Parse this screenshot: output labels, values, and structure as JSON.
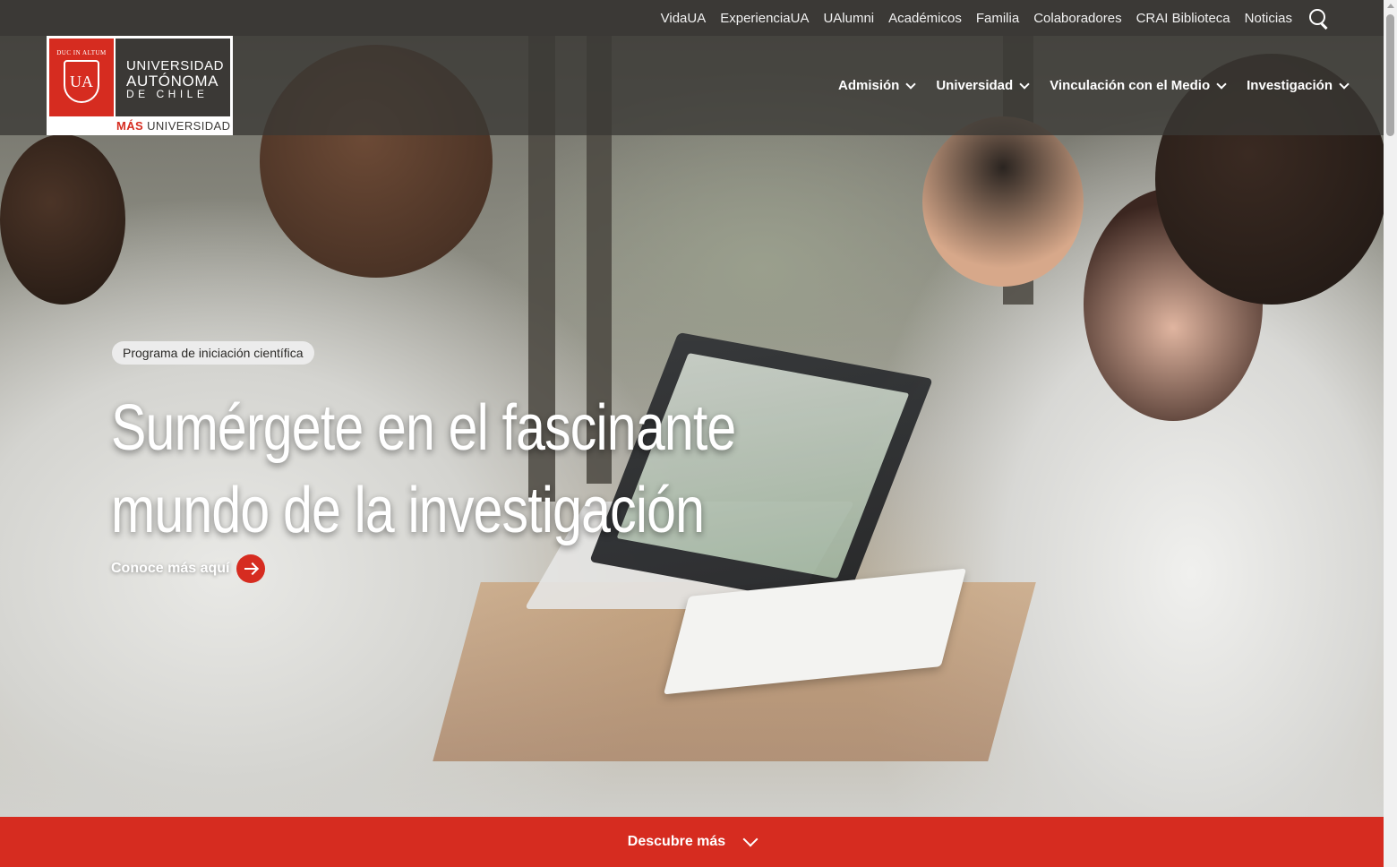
{
  "utility_nav": [
    "VidaUA",
    "ExperienciaUA",
    "UAlumni",
    "Académicos",
    "Familia",
    "Colaboradores",
    "CRAI Biblioteca",
    "Noticias"
  ],
  "logo": {
    "motto": "DUC IN ALTUM",
    "monogram": "UA",
    "line1": "UNIVERSIDAD",
    "line2": "AUTÓNOMA",
    "line3": "DE CHILE",
    "tag_bold": "MÁS",
    "tag_rest": " UNIVERSIDAD"
  },
  "main_nav": [
    "Admisión",
    "Universidad",
    "Vinculación con el Medio",
    "Investigación"
  ],
  "hero": {
    "tag": "Programa de iniciación científica",
    "headline_line1": "Sumérgete en el fascinante",
    "headline_line2": "mundo de la investigación",
    "cta": "Conoce más aquí"
  },
  "discover": "Descubre más",
  "icons": {
    "search": "search-icon",
    "nav_chevron": "chevron-down-icon",
    "cta_arrow": "arrow-right-icon",
    "discover_chevron": "chevron-down-icon"
  },
  "colors": {
    "brand_red": "#d62c20",
    "top_bar": "#3b3936"
  }
}
